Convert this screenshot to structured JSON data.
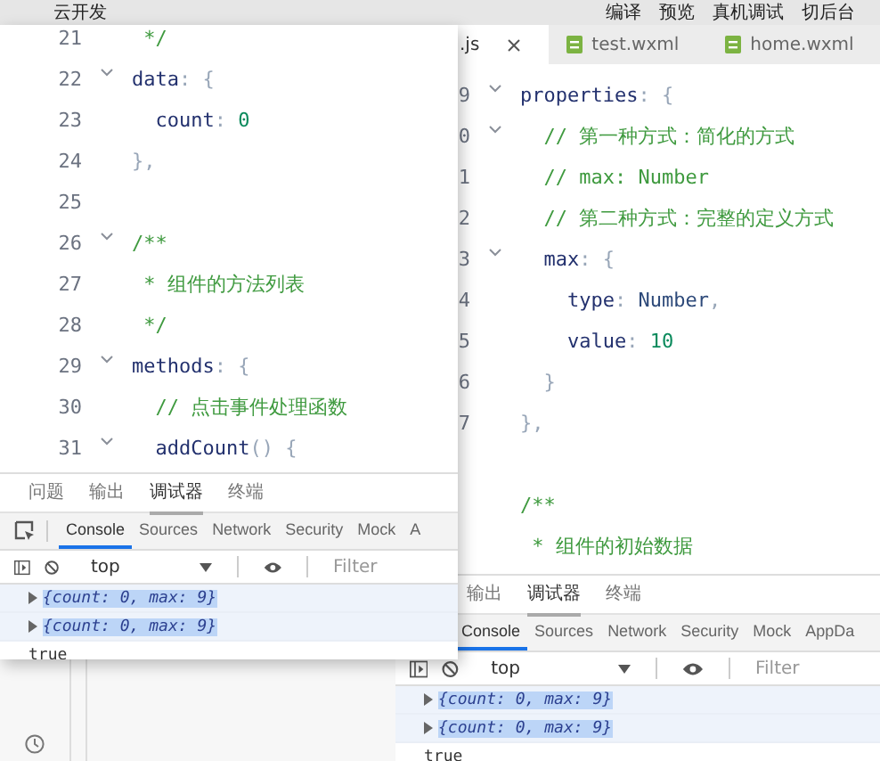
{
  "menubar": {
    "left": [
      "云开发"
    ],
    "right": [
      "编译",
      "预览",
      "真机调试",
      "切后台"
    ]
  },
  "background_editor": {
    "tabs": [
      {
        "label": ".js",
        "selected": true,
        "closable": true
      },
      {
        "label": "test.wxml",
        "selected": false,
        "closable": false
      },
      {
        "label": "home.wxml",
        "selected": false,
        "closable": false
      }
    ],
    "lines": [
      {
        "num": "9",
        "fold": true,
        "tokens": [
          {
            "kind": "key",
            "text": "properties"
          },
          {
            "kind": "punct",
            "text": ": {"
          }
        ]
      },
      {
        "num": "0",
        "fold": true,
        "tokens": [
          {
            "kind": "comment",
            "text": "  // 第一种方式：简化的方式"
          }
        ]
      },
      {
        "num": "1",
        "fold": false,
        "tokens": [
          {
            "kind": "comment",
            "text": "  // max: Number"
          }
        ]
      },
      {
        "num": "2",
        "fold": false,
        "tokens": [
          {
            "kind": "comment",
            "text": "  // 第二种方式：完整的定义方式"
          }
        ]
      },
      {
        "num": "3",
        "fold": true,
        "tokens": [
          {
            "kind": "key",
            "text": "  max"
          },
          {
            "kind": "punct",
            "text": ": {"
          }
        ]
      },
      {
        "num": "4",
        "fold": false,
        "tokens": [
          {
            "kind": "key",
            "text": "    type"
          },
          {
            "kind": "punct",
            "text": ": "
          },
          {
            "kind": "plain",
            "text": "Number"
          },
          {
            "kind": "punct",
            "text": ","
          }
        ]
      },
      {
        "num": "5",
        "fold": false,
        "tokens": [
          {
            "kind": "key",
            "text": "    value"
          },
          {
            "kind": "punct",
            "text": ": "
          },
          {
            "kind": "number",
            "text": "10"
          }
        ]
      },
      {
        "num": "6",
        "fold": false,
        "tokens": [
          {
            "kind": "punct",
            "text": "  }"
          }
        ]
      },
      {
        "num": "7",
        "fold": false,
        "tokens": [
          {
            "kind": "punct",
            "text": "},"
          }
        ]
      },
      {
        "fold": false
      },
      {
        "fold": false,
        "tokens": [
          {
            "kind": "comment",
            "text": "/**"
          }
        ]
      },
      {
        "fold": false,
        "tokens": [
          {
            "kind": "comment",
            "text": " * 组件的初始数据"
          }
        ]
      }
    ],
    "panel": {
      "tabs": [
        {
          "label": "输出",
          "selected": false
        },
        {
          "label": "调试器",
          "selected": true
        },
        {
          "label": "终端",
          "selected": false
        }
      ],
      "devtools_tabs": [
        {
          "label": "Console",
          "selected": true
        },
        {
          "label": "Sources",
          "selected": false
        },
        {
          "label": "Network",
          "selected": false
        },
        {
          "label": "Security",
          "selected": false
        },
        {
          "label": "Mock",
          "selected": false
        },
        {
          "label": "AppDa",
          "selected": false
        }
      ],
      "context": "top",
      "filter_placeholder": "Filter",
      "logs": [
        {
          "kind": "object",
          "text": "{count: 0, max: 9}"
        },
        {
          "kind": "object",
          "text": "{count: 0, max: 9}"
        },
        {
          "kind": "value",
          "text": "true"
        }
      ]
    }
  },
  "floating_window": {
    "lines": [
      {
        "num": "21",
        "fold": false,
        "tokens": [
          {
            "kind": "comment",
            "text": " */"
          }
        ]
      },
      {
        "num": "22",
        "fold": true,
        "tokens": [
          {
            "kind": "key",
            "text": "data"
          },
          {
            "kind": "punct",
            "text": ": {"
          }
        ]
      },
      {
        "num": "23",
        "fold": false,
        "tokens": [
          {
            "kind": "key",
            "text": "  count"
          },
          {
            "kind": "punct",
            "text": ": "
          },
          {
            "kind": "number",
            "text": "0"
          }
        ]
      },
      {
        "num": "24",
        "fold": false,
        "tokens": [
          {
            "kind": "punct",
            "text": "},"
          }
        ]
      },
      {
        "num": "25",
        "fold": false
      },
      {
        "num": "26",
        "fold": true,
        "tokens": [
          {
            "kind": "comment",
            "text": "/**"
          }
        ]
      },
      {
        "num": "27",
        "fold": false,
        "tokens": [
          {
            "kind": "comment",
            "text": " * 组件的方法列表"
          }
        ]
      },
      {
        "num": "28",
        "fold": false,
        "tokens": [
          {
            "kind": "comment",
            "text": " */"
          }
        ]
      },
      {
        "num": "29",
        "fold": true,
        "tokens": [
          {
            "kind": "key",
            "text": "methods"
          },
          {
            "kind": "punct",
            "text": ": {"
          }
        ]
      },
      {
        "num": "30",
        "fold": false,
        "tokens": [
          {
            "kind": "comment",
            "text": "  // 点击事件处理函数"
          }
        ]
      },
      {
        "num": "31",
        "fold": true,
        "tokens": [
          {
            "kind": "key",
            "text": "  addCount"
          },
          {
            "kind": "punct",
            "text": "() {"
          }
        ]
      }
    ],
    "panel": {
      "tabs": [
        {
          "label": "问题",
          "selected": false
        },
        {
          "label": "输出",
          "selected": false
        },
        {
          "label": "调试器",
          "selected": true
        },
        {
          "label": "终端",
          "selected": false
        }
      ],
      "devtools_tabs": [
        {
          "label": "Console",
          "selected": true
        },
        {
          "label": "Sources",
          "selected": false
        },
        {
          "label": "Network",
          "selected": false
        },
        {
          "label": "Security",
          "selected": false
        },
        {
          "label": "Mock",
          "selected": false
        },
        {
          "label": "A",
          "selected": false
        }
      ],
      "context": "top",
      "filter_placeholder": "Filter",
      "logs": [
        {
          "kind": "object",
          "text": "{count: 0, max: 9}"
        },
        {
          "kind": "object",
          "text": "{count: 0, max: 9}"
        },
        {
          "kind": "value",
          "text": "true"
        }
      ]
    }
  }
}
